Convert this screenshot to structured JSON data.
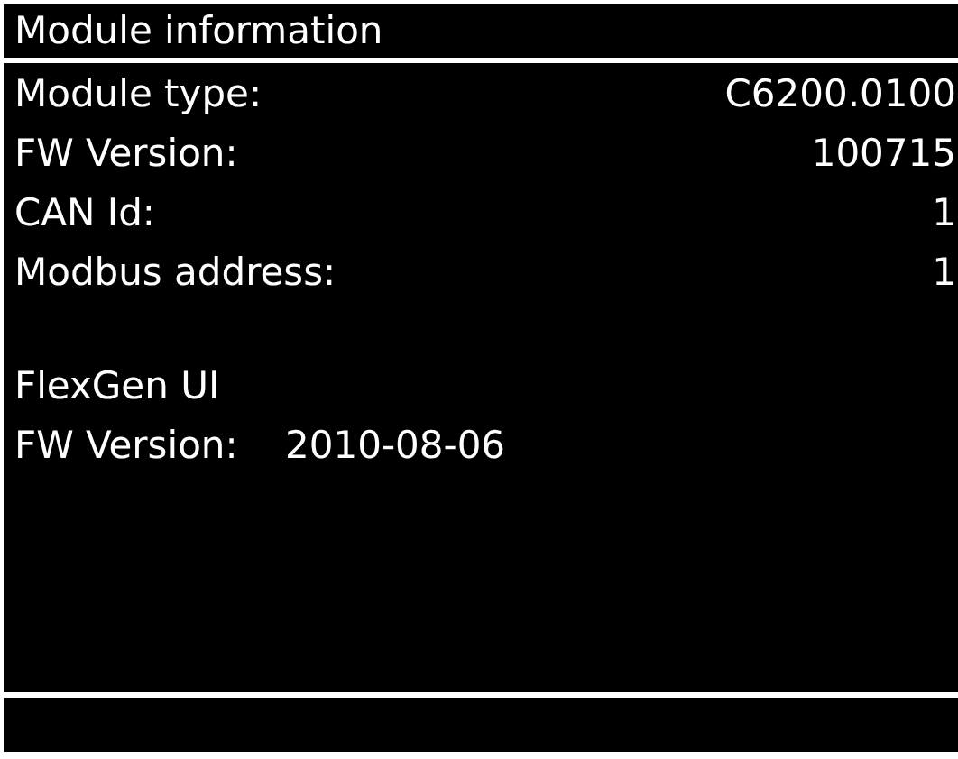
{
  "header": {
    "title": "Module information"
  },
  "rows": [
    {
      "label": "Module type:",
      "value": "C6200.0100"
    },
    {
      "label": "FW Version:",
      "value": "100715"
    },
    {
      "label": "CAN Id:",
      "value": "1"
    },
    {
      "label": "Modbus address:",
      "value": "1"
    }
  ],
  "section": {
    "title": "FlexGen UI",
    "label": "FW Version:",
    "value": "2010-08-06"
  }
}
